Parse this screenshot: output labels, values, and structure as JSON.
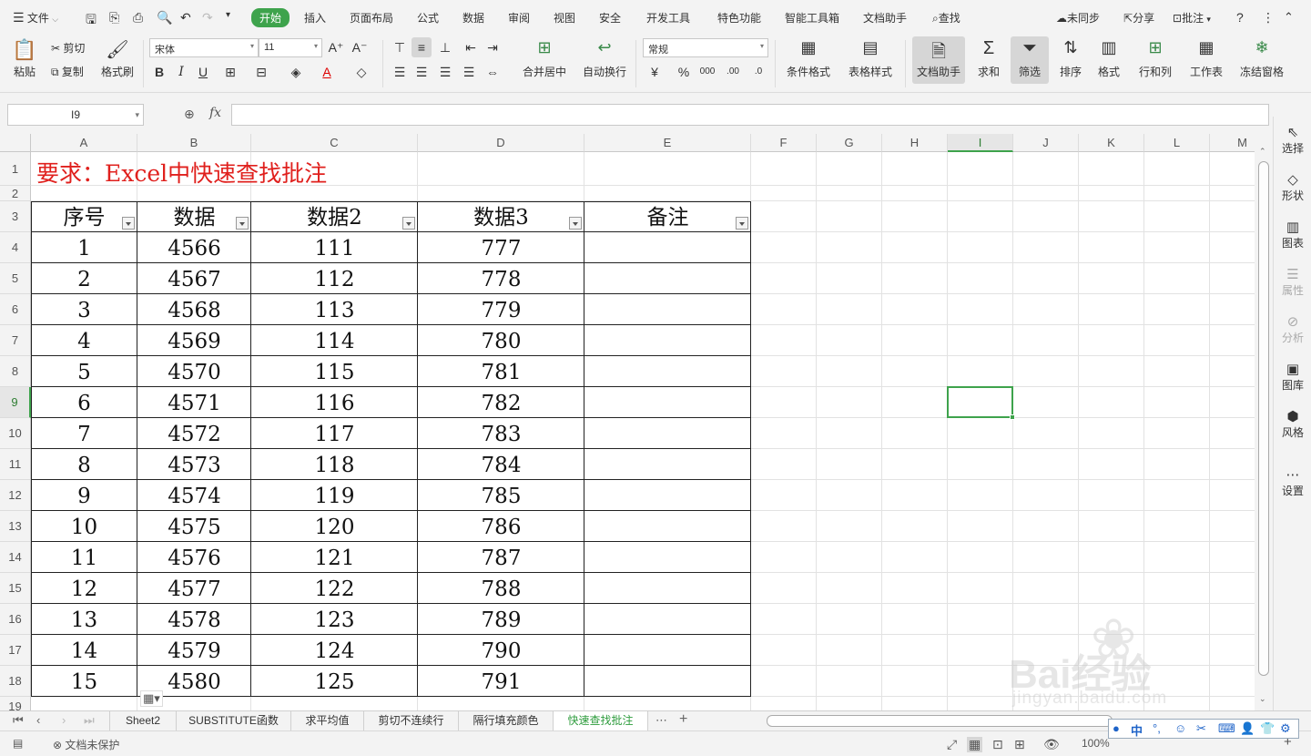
{
  "menubar": {
    "file_label": "文件",
    "tabs": [
      "开始",
      "插入",
      "页面布局",
      "公式",
      "数据",
      "审阅",
      "视图",
      "安全",
      "开发工具",
      "特色功能",
      "智能工具箱",
      "文档助手"
    ],
    "search_label": "查找",
    "sync_label": "未同步",
    "share_label": "分享",
    "comment_label": "批注"
  },
  "ribbon": {
    "paste": "粘贴",
    "cut": "剪切",
    "copy": "复制",
    "format_painter": "格式刷",
    "font_name": "宋体",
    "font_size": "11",
    "merge_center": "合并居中",
    "wrap_text": "自动换行",
    "number_format": "常规",
    "conditional_format": "条件格式",
    "table_style": "表格样式",
    "doc_assistant": "文档助手",
    "sum": "求和",
    "filter": "筛选",
    "sort": "排序",
    "format": "格式",
    "rows_cols": "行和列",
    "worksheet": "工作表",
    "freeze": "冻结窗格"
  },
  "formula_bar": {
    "cell_ref": "I9",
    "fx_label": "fx",
    "formula_value": ""
  },
  "grid": {
    "columns": [
      "A",
      "B",
      "C",
      "D",
      "E",
      "F",
      "G",
      "H",
      "I",
      "J",
      "K",
      "L",
      "M"
    ],
    "current_column": "I",
    "current_row": "9",
    "rows": [
      "1",
      "2",
      "3",
      "4",
      "5",
      "6",
      "7",
      "8",
      "9",
      "10",
      "11",
      "12",
      "13",
      "14",
      "15",
      "16",
      "17",
      "18",
      "19"
    ],
    "title": "要求：Excel中快速查找批注",
    "headers": [
      "序号",
      "数据",
      "数据2",
      "数据3",
      "备注"
    ],
    "data_rows": [
      [
        "1",
        "4566",
        "111",
        "777",
        ""
      ],
      [
        "2",
        "4567",
        "112",
        "778",
        ""
      ],
      [
        "3",
        "4568",
        "113",
        "779",
        ""
      ],
      [
        "4",
        "4569",
        "114",
        "780",
        ""
      ],
      [
        "5",
        "4570",
        "115",
        "781",
        ""
      ],
      [
        "6",
        "4571",
        "116",
        "782",
        ""
      ],
      [
        "7",
        "4572",
        "117",
        "783",
        ""
      ],
      [
        "8",
        "4573",
        "118",
        "784",
        ""
      ],
      [
        "9",
        "4574",
        "119",
        "785",
        ""
      ],
      [
        "10",
        "4575",
        "120",
        "786",
        ""
      ],
      [
        "11",
        "4576",
        "121",
        "787",
        ""
      ],
      [
        "12",
        "4577",
        "122",
        "788",
        ""
      ],
      [
        "13",
        "4578",
        "123",
        "789",
        ""
      ],
      [
        "14",
        "4579",
        "124",
        "790",
        ""
      ],
      [
        "15",
        "4580",
        "125",
        "791",
        ""
      ]
    ]
  },
  "side_panel": [
    "选择",
    "形状",
    "图表",
    "属性",
    "分析",
    "图库",
    "风格",
    "设置"
  ],
  "sheet_tabs": [
    "Sheet2",
    "SUBSTITUTE函数",
    "求平均值",
    "剪切不连续行",
    "隔行填充颜色",
    "快速查找批注"
  ],
  "active_sheet": "快速查找批注",
  "status": {
    "protect_label": "文档未保护",
    "zoom": "100%"
  },
  "ime": [
    "中",
    "°,",
    "☺",
    "✂",
    "⌨",
    "👤",
    "👕",
    "⚙"
  ],
  "watermark": {
    "brand": "Bai经验",
    "url": "jingyan.baidu.com"
  },
  "colors": {
    "accent": "#3ea34c",
    "title_red": "#e0201d"
  }
}
